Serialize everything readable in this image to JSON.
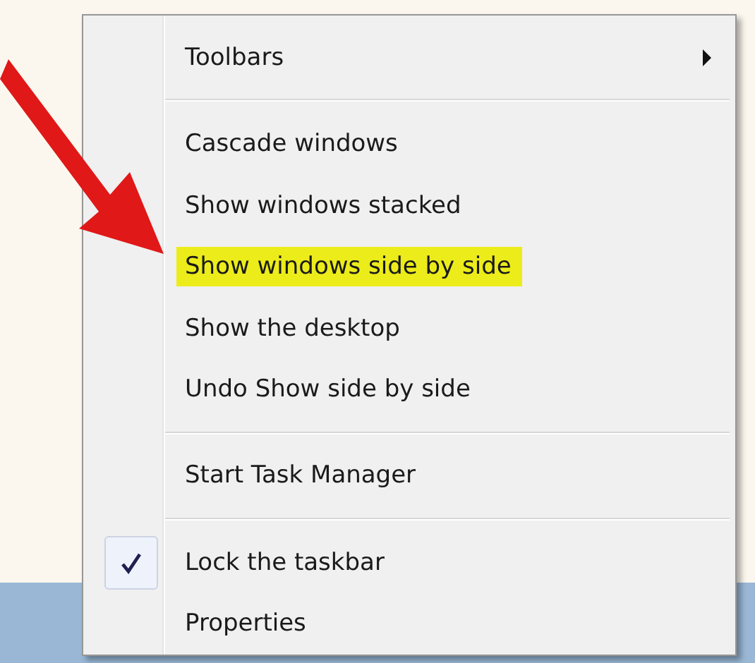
{
  "context_menu": {
    "items": [
      {
        "kind": "item",
        "label": "Toolbars",
        "submenu": true,
        "checked": false,
        "highlighted": false
      },
      {
        "kind": "separator"
      },
      {
        "kind": "item",
        "label": "Cascade windows",
        "submenu": false,
        "checked": false,
        "highlighted": false
      },
      {
        "kind": "item",
        "label": "Show windows stacked",
        "submenu": false,
        "checked": false,
        "highlighted": false
      },
      {
        "kind": "item",
        "label": "Show windows side by side",
        "submenu": false,
        "checked": false,
        "highlighted": true
      },
      {
        "kind": "item",
        "label": "Show the desktop",
        "submenu": false,
        "checked": false,
        "highlighted": false
      },
      {
        "kind": "item",
        "label": "Undo Show side by side",
        "submenu": false,
        "checked": false,
        "highlighted": false
      },
      {
        "kind": "separator"
      },
      {
        "kind": "item",
        "label": "Start Task Manager",
        "submenu": false,
        "checked": false,
        "highlighted": false
      },
      {
        "kind": "separator"
      },
      {
        "kind": "item",
        "label": "Lock the taskbar",
        "submenu": false,
        "checked": true,
        "highlighted": false
      },
      {
        "kind": "item",
        "label": "Properties",
        "submenu": false,
        "checked": false,
        "highlighted": false
      }
    ]
  }
}
